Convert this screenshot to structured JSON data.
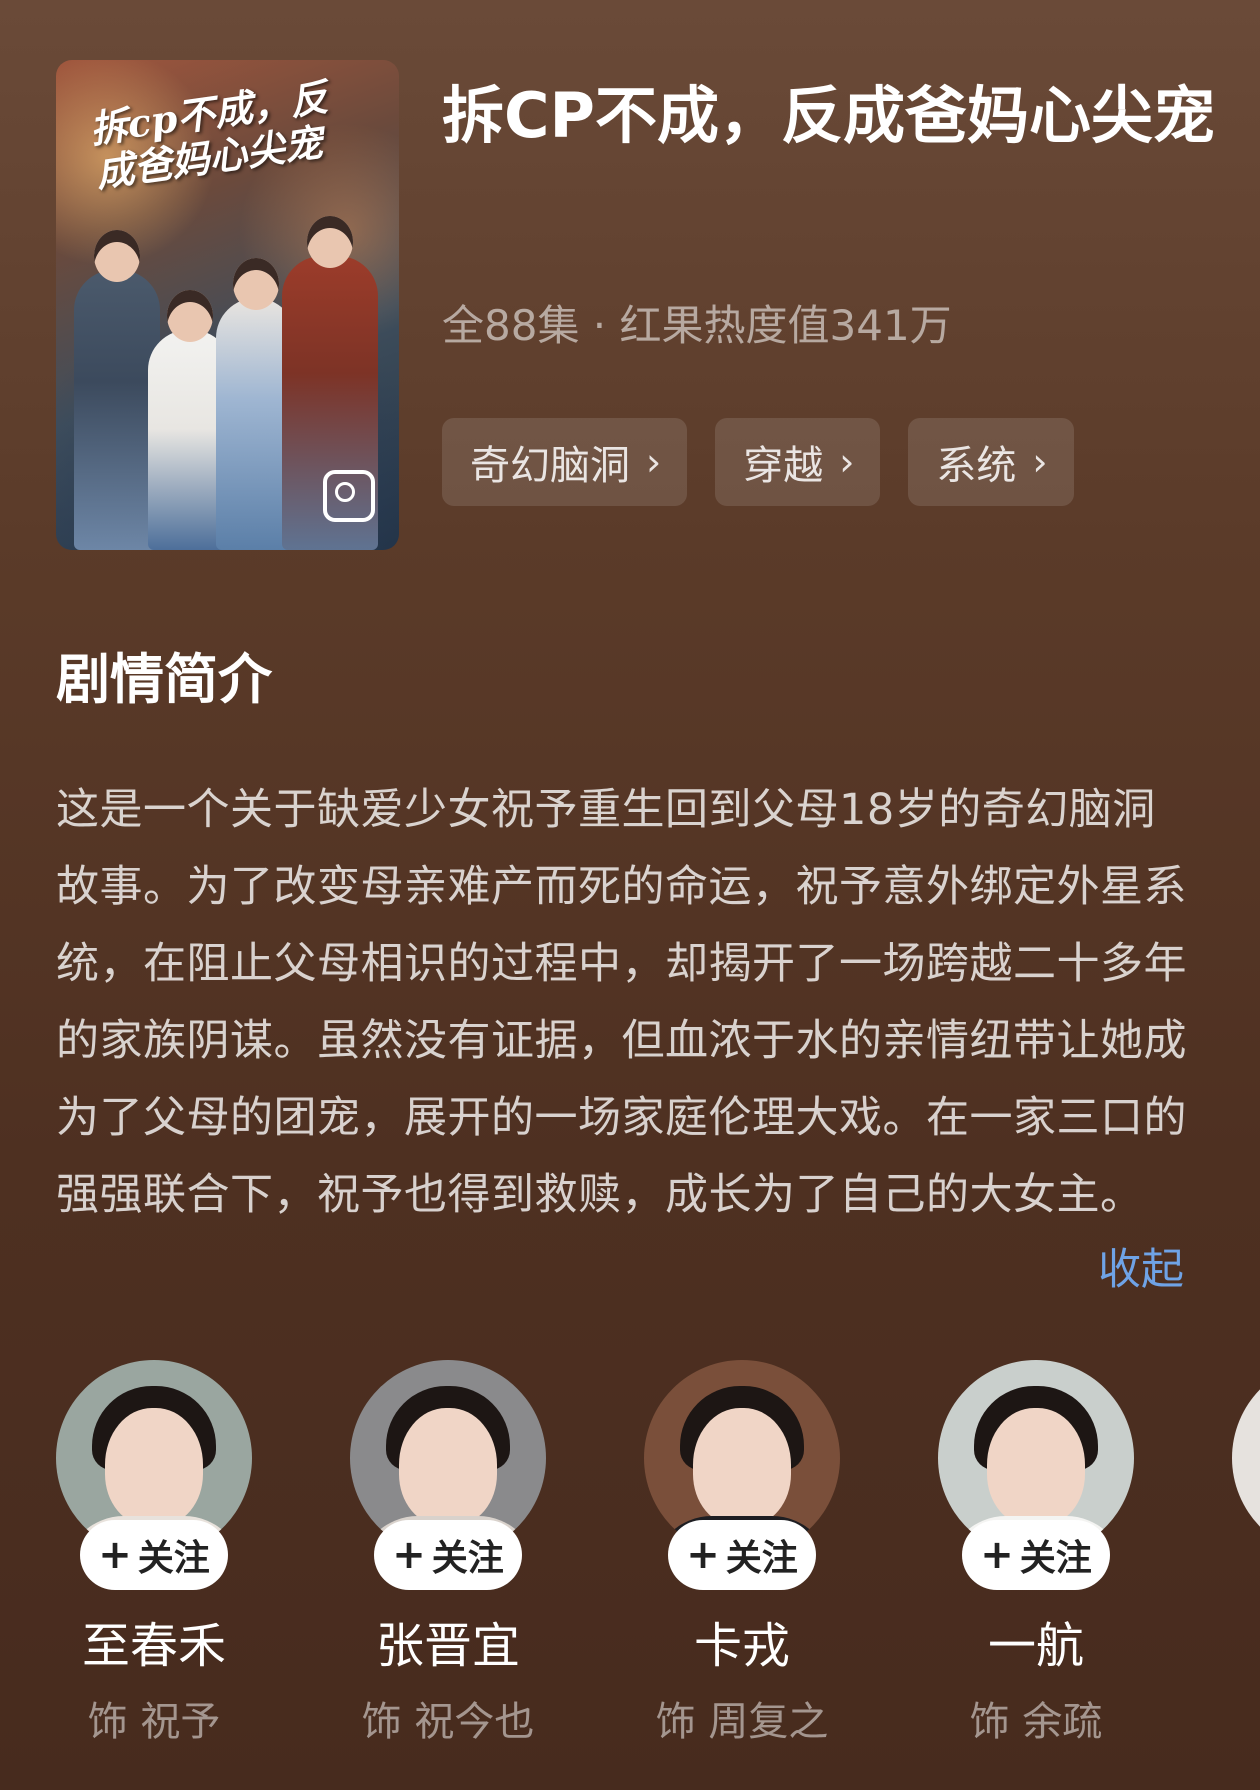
{
  "drama": {
    "poster_title": "拆cp不成，反成爸妈心尖宠",
    "title": "拆CP不成，反成爸妈心尖宠",
    "meta": "全88集 · 红果热度值341万",
    "tags": [
      {
        "label": "奇幻脑洞",
        "icon": "chevron-right-icon"
      },
      {
        "label": "穿越",
        "icon": "chevron-right-icon"
      },
      {
        "label": "系统",
        "icon": "chevron-right-icon"
      }
    ]
  },
  "synopsis": {
    "heading": "剧情简介",
    "text": "这是一个关于缺爱少女祝予重生回到父母18岁的奇幻脑洞故事。为了改变母亲难产而死的命运，祝予意外绑定外星系统，在阻止父母相识的过程中，却揭开了一场跨越二十多年的家族阴谋。虽然没有证据，但血浓于水的亲情纽带让她成为了父母的团宠，展开的一场家庭伦理大戏。在一家三口的强强联合下，祝予也得到救赎，成长为了自己的大女主。",
    "collapse_label": "收起"
  },
  "cast": [
    {
      "name": "至春禾",
      "role": "饰 祝予",
      "follow_label": "关注",
      "follow_icon": "plus-icon",
      "avatar_color": "#9aa6a0",
      "shirt_color": "#e8e2dc"
    },
    {
      "name": "张晋宜",
      "role": "饰 祝今也",
      "follow_label": "关注",
      "follow_icon": "plus-icon",
      "avatar_color": "#8a8a8c",
      "shirt_color": "#d9d2cc"
    },
    {
      "name": "卡戎",
      "role": "饰 周复之",
      "follow_label": "关注",
      "follow_icon": "plus-icon",
      "avatar_color": "#7a4f3a",
      "shirt_color": "#1e1e22"
    },
    {
      "name": "一航",
      "role": "饰 余疏",
      "follow_label": "关注",
      "follow_icon": "plus-icon",
      "avatar_color": "#c9cfcc",
      "shirt_color": "#f4f4f2"
    }
  ],
  "colors": {
    "background": "#5b3b29",
    "link": "#6fa3e6",
    "follow_button": "#ffffff"
  }
}
